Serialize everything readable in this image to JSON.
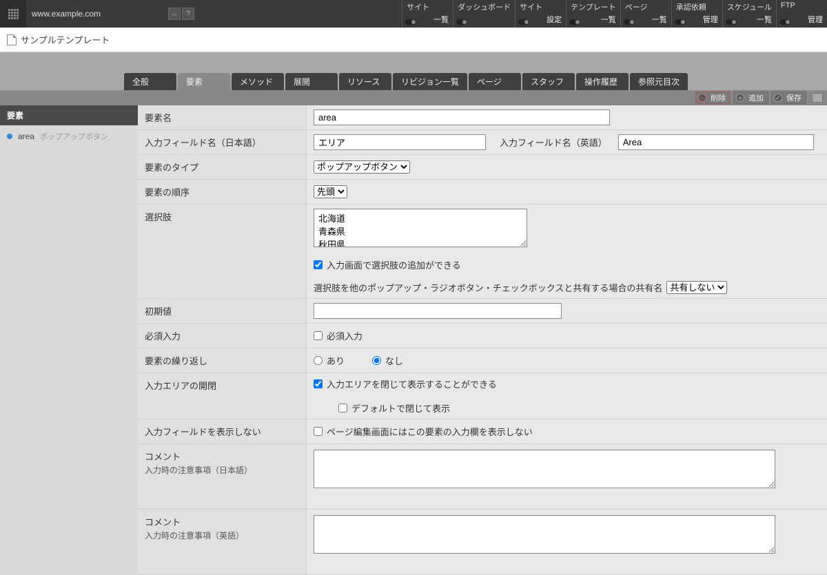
{
  "top": {
    "url": "www.example.com",
    "menu": [
      {
        "label": "サイト",
        "sub": "一覧"
      },
      {
        "label": "ダッシュボード",
        "sub": ""
      },
      {
        "label": "サイト",
        "sub": "設定"
      },
      {
        "label": "テンプレート",
        "sub": "一覧"
      },
      {
        "label": "ページ",
        "sub": "一覧"
      },
      {
        "label": "承認依頼",
        "sub": "管理"
      },
      {
        "label": "スケジュール",
        "sub": "一覧"
      },
      {
        "label": "FTP",
        "sub": "管理"
      }
    ]
  },
  "breadcrumb": {
    "title": "サンプルテンプレート"
  },
  "tabs": [
    "全般",
    "要素",
    "メソッド",
    "展開",
    "リソース",
    "リビジョン一覧",
    "ページ",
    "スタッフ",
    "操作履歴",
    "参照元目次"
  ],
  "activeTab": 1,
  "toolbar": {
    "delete": "削除",
    "add": "追加",
    "save": "保存"
  },
  "sidebar": {
    "head": "要素",
    "items": [
      {
        "name": "area",
        "type": "ポップアップボタン"
      }
    ]
  },
  "form": {
    "element_name": {
      "label": "要素名",
      "value": "area"
    },
    "input_ja": {
      "label": "入力フィールド名（日本語）",
      "value": "エリア"
    },
    "input_en": {
      "label": "入力フィールド名（英語）",
      "value": "Area"
    },
    "type": {
      "label": "要素のタイプ",
      "options": [
        "ポップアップボタン"
      ],
      "value": "ポップアップボタン"
    },
    "order": {
      "label": "要素の順序",
      "options": [
        "先頭"
      ],
      "value": "先頭"
    },
    "choices": {
      "label": "選択肢",
      "value": "北海道\n青森県\n秋田県",
      "checkbox": "入力画面で選択肢の追加ができる",
      "share_text": "選択肢を他のポップアップ・ラジオボタン・チェックボックスと共有する場合の共有名",
      "share_options": [
        "共有しない"
      ]
    },
    "default": {
      "label": "初期値",
      "value": ""
    },
    "required": {
      "label": "必須入力",
      "checkbox": "必須入力"
    },
    "repeat": {
      "label": "要素の繰り返し",
      "yes": "あり",
      "no": "なし"
    },
    "collapse": {
      "label": "入力エリアの開閉",
      "checkbox": "入力エリアを閉じて表示することができる",
      "sub": "デフォルトで閉じて表示"
    },
    "hide": {
      "label": "入力フィールドを表示しない",
      "checkbox": "ページ編集画面にはこの要素の入力欄を表示しない"
    },
    "comment_ja": {
      "label": "コメント",
      "sub": "入力時の注意事項（日本語）"
    },
    "comment_en": {
      "label": "コメント",
      "sub": "入力時の注意事項（英語）"
    }
  }
}
